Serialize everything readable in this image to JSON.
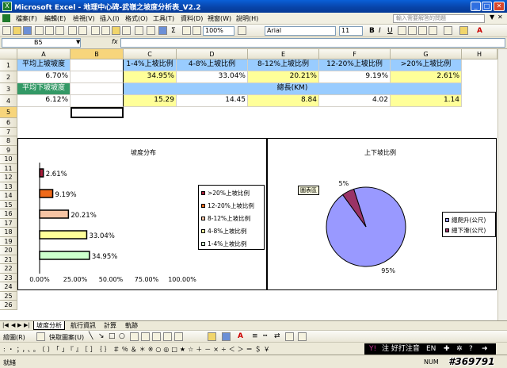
{
  "window": {
    "title": "Microsoft Excel - 地理中心碑-武嶺之坡度分析表_V2.2",
    "app_icon": "X"
  },
  "menu": {
    "items": [
      "檔案(F)",
      "編輯(E)",
      "檢視(V)",
      "插入(I)",
      "格式(O)",
      "工具(T)",
      "資料(D)",
      "視窗(W)",
      "說明(H)"
    ],
    "help_placeholder": "輸入需要解答的問題"
  },
  "toolbar": {
    "zoom": "100%",
    "font": "Arial",
    "size": "11",
    "bold": "B",
    "italic": "I",
    "underline": "U"
  },
  "formula": {
    "namebox": "B5",
    "fx": "fx",
    "value": ""
  },
  "grid": {
    "columns": [
      "A",
      "B",
      "C",
      "D",
      "E",
      "F",
      "G",
      "H"
    ],
    "rows": [
      "1",
      "2",
      "3",
      "4",
      "5",
      "6",
      "7",
      "8",
      "9",
      "10",
      "11",
      "12",
      "13",
      "14",
      "15",
      "16",
      "17",
      "18",
      "19",
      "20",
      "21",
      "22",
      "23",
      "24",
      "25",
      "26"
    ],
    "a1": "平均上坡坡度",
    "a2": "6.70%",
    "a3": "平均下坡坡度",
    "a4": "6.12%",
    "c1": "1-4%上坡比例",
    "d1": "4-8%上坡比例",
    "e1": "8-12%上坡比例",
    "f1": "12-20%上坡比例",
    "g1": ">20%上坡比例",
    "c2": "34.95%",
    "d2": "33.04%",
    "e2": "20.21%",
    "f2": "9.19%",
    "g2": "2.61%",
    "c3": "總長(KM)",
    "c4": "15.29",
    "d4": "14.45",
    "e4": "8.84",
    "f4": "4.02",
    "g4": "1.14"
  },
  "chart_data": [
    {
      "type": "bar",
      "title": "坡度分布",
      "orientation": "horizontal",
      "categories": [
        ">20%上坡比例",
        "12-20%上坡比例",
        "8-12%上坡比例",
        "4-8%上坡比例",
        "1-4%上坡比例"
      ],
      "values": [
        2.61,
        9.19,
        20.21,
        33.04,
        34.95
      ],
      "data_labels": [
        "2.61%",
        "9.19%",
        "20.21%",
        "33.04%",
        "34.95%"
      ],
      "colors": [
        "#a81e3b",
        "#ef6a1a",
        "#f6c4a4",
        "#ffff99",
        "#ccffcc"
      ],
      "xlim": [
        0,
        100
      ],
      "xticks": [
        "0.00%",
        "25.00%",
        "50.00%",
        "75.00%",
        "100.00%"
      ],
      "legend": "right",
      "grid": false
    },
    {
      "type": "pie",
      "title": "上下坡比例",
      "categories": [
        "總爬升(公尺)",
        "總下滑(公尺)"
      ],
      "values": [
        95,
        5
      ],
      "data_labels": [
        "95%",
        "5%"
      ],
      "colors": [
        "#9999ff",
        "#993366"
      ],
      "legend": "right",
      "tooltip": "圖表區"
    }
  ],
  "sheets": {
    "tabs": [
      "坡度分析",
      "航行資訊",
      "計算",
      "軌跡"
    ],
    "active": "坡度分析"
  },
  "drawbar": {
    "draw": "繪圖(R)",
    "autoshape": "快取圖案(U)"
  },
  "symbols": ":・；，、。〔〕「」『』［］｛｝＃％＆＊※○◎□★☆＋－×÷＜＞＝＄￥",
  "ime": {
    "label": "注 好打注音",
    "lang": "EN"
  },
  "status": {
    "text": "就緒",
    "num": "NUM",
    "watermark": "#369791"
  }
}
